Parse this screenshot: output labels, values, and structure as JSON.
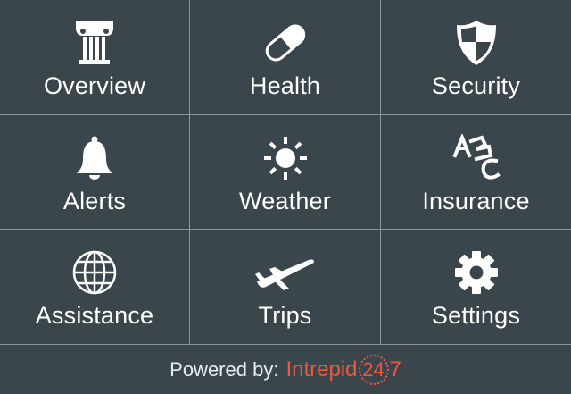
{
  "tiles": [
    {
      "label": "Overview",
      "icon": "column-icon"
    },
    {
      "label": "Health",
      "icon": "pill-icon"
    },
    {
      "label": "Security",
      "icon": "shield-icon"
    },
    {
      "label": "Alerts",
      "icon": "bell-icon"
    },
    {
      "label": "Weather",
      "icon": "sun-icon"
    },
    {
      "label": "Insurance",
      "icon": "abc-blocks-icon"
    },
    {
      "label": "Assistance",
      "icon": "globe-icon"
    },
    {
      "label": "Trips",
      "icon": "airplane-icon"
    },
    {
      "label": "Settings",
      "icon": "gear-icon"
    }
  ],
  "footer": {
    "powered_label": "Powered by:",
    "brand_name": "Intrepid",
    "brand_number": "24",
    "brand_suffix": "7"
  },
  "colors": {
    "background": "#3b454c",
    "divider": "#8e979c",
    "text": "#ffffff",
    "brand": "#ec5a3e"
  }
}
